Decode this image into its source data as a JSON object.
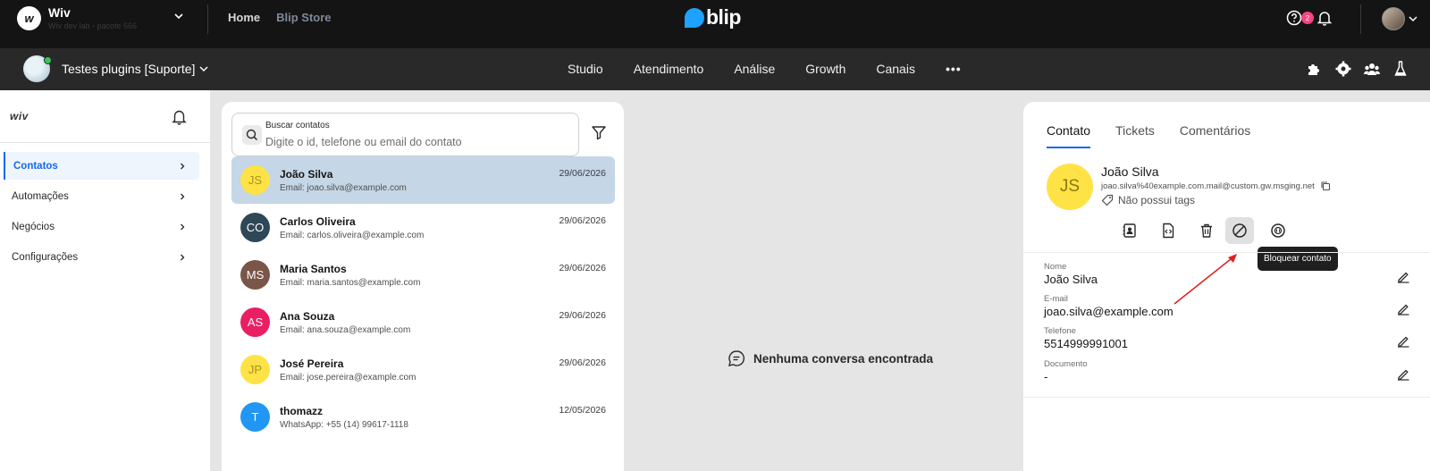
{
  "topbar": {
    "org_name": "Wiv",
    "org_subtitle": "Wiv dev lab - pacote 666",
    "org_logo_text": "w",
    "nav": {
      "home": "Home",
      "store": "Blip Store"
    },
    "brand": "blip",
    "notifications_count": "2",
    "colors": {
      "background": "#141414",
      "brand": "#1ea2ff",
      "badge": "#f9447f"
    }
  },
  "subbar": {
    "bot_name": "Testes plugins [Suporte]",
    "nav": [
      "Studio",
      "Atendimento",
      "Análise",
      "Growth",
      "Canais"
    ],
    "more_icon": "more-horizontal-icon"
  },
  "sidebar": {
    "logo_text": "wiv",
    "items": [
      {
        "label": "Contatos",
        "active": true
      },
      {
        "label": "Automações",
        "active": false
      },
      {
        "label": "Negócios",
        "active": false
      },
      {
        "label": "Configurações",
        "active": false
      }
    ]
  },
  "contacts": {
    "search_label": "Buscar contatos",
    "search_placeholder": "Digite o id, telefone ou email do contato",
    "list": [
      {
        "initials": "JS",
        "name": "João Silva",
        "sub": "Email: joao.silva@example.com",
        "date": "29/06/2026",
        "color": "#ffe245",
        "text_color": "#a8941b",
        "selected": true
      },
      {
        "initials": "CO",
        "name": "Carlos Oliveira",
        "sub": "Email: carlos.oliveira@example.com",
        "date": "29/06/2026",
        "color": "#2f4858",
        "text_color": "#ffffff",
        "selected": false
      },
      {
        "initials": "MS",
        "name": "Maria Santos",
        "sub": "Email: maria.santos@example.com",
        "date": "29/06/2026",
        "color": "#7a5548",
        "text_color": "#ffffff",
        "selected": false
      },
      {
        "initials": "AS",
        "name": "Ana Souza",
        "sub": "Email: ana.souza@example.com",
        "date": "29/06/2026",
        "color": "#e91e63",
        "text_color": "#ffffff",
        "selected": false
      },
      {
        "initials": "JP",
        "name": "José Pereira",
        "sub": "Email: jose.pereira@example.com",
        "date": "29/06/2026",
        "color": "#ffe245",
        "text_color": "#a8941b",
        "selected": false
      },
      {
        "initials": "T",
        "name": "thomazz",
        "sub": "WhatsApp: +55 (14) 99617-1118",
        "date": "12/05/2026",
        "color": "#2196f3",
        "text_color": "#ffffff",
        "selected": false
      }
    ]
  },
  "conversation": {
    "empty_message": "Nenhuma conversa encontrada"
  },
  "details": {
    "tabs": [
      "Contato",
      "Tickets",
      "Comentários"
    ],
    "active_tab": "Contato",
    "initials": "JS",
    "name": "João Silva",
    "identity": "joao.silva%40example.com.mail@custom.gw.msging.net",
    "tags": "Não possui tags",
    "actions": [
      "contact-card-icon",
      "code-file-icon",
      "trash-icon",
      "block-icon",
      "sticker-icon"
    ],
    "tooltip": "Bloquear contato",
    "fields": [
      {
        "label": "Nome",
        "value": "João Silva"
      },
      {
        "label": "E-mail",
        "value": "joao.silva@example.com"
      },
      {
        "label": "Telefone",
        "value": "5514999991001"
      },
      {
        "label": "Documento",
        "value": "-"
      }
    ]
  }
}
